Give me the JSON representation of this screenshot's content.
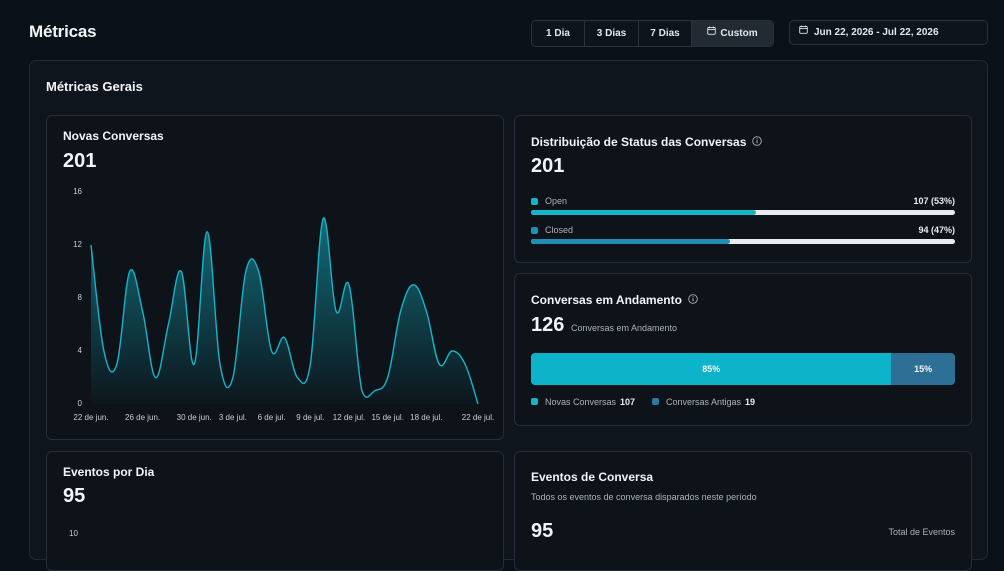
{
  "header": {
    "title": "Métricas",
    "ranges": [
      "1 Dia",
      "3 Dias",
      "7 Dias",
      "Custom"
    ],
    "active_range": "Custom",
    "date_range": "Jun 22, 2026 - Jul 22, 2026"
  },
  "section": {
    "title": "Métricas Gerais"
  },
  "novas_conversas": {
    "title": "Novas Conversas",
    "total": "201"
  },
  "status_dist": {
    "title": "Distribuição de Status das Conversas",
    "total": "201",
    "rows": [
      {
        "label": "Open",
        "value_text": "107 (53%)",
        "fraction": 0.53,
        "color": "#16b4c9"
      },
      {
        "label": "Closed",
        "value_text": "94 (47%)",
        "fraction": 0.47,
        "color": "#1f8fb5"
      }
    ]
  },
  "andamento": {
    "title": "Conversas em Andamento",
    "total": "126",
    "subtitle": "Conversas em Andamento",
    "segments": [
      {
        "label": "85%",
        "fraction": 0.85,
        "color": "#0db4c9"
      },
      {
        "label": "15%",
        "fraction": 0.15,
        "color": "#2e6f96"
      }
    ],
    "legend": [
      {
        "label": "Novas Conversas",
        "value": "107",
        "color": "#16b4c9"
      },
      {
        "label": "Conversas Antigas",
        "value": "19",
        "color": "#2e7aa3"
      }
    ]
  },
  "eventos_dia": {
    "title": "Eventos por Dia",
    "total": "95",
    "y_top_tick": "10"
  },
  "eventos_conversa": {
    "title": "Eventos de Conversa",
    "subtitle": "Todos os eventos de conversa disparados neste período",
    "total": "95",
    "total_label": "Total de Eventos"
  },
  "chart_data": {
    "type": "area",
    "title": "Novas Conversas",
    "xlabel": "",
    "ylabel": "",
    "ylim": [
      0,
      16
    ],
    "y_ticks": [
      "0",
      "4",
      "8",
      "12",
      "16"
    ],
    "x_ticks": [
      "22 de jun.",
      "26 de jun.",
      "30 de jun.",
      "3 de jul.",
      "6 de jul.",
      "9 de jul.",
      "12 de jul.",
      "15 de jul.",
      "18 de jul.",
      "22 de jul."
    ],
    "x": [
      "22 de jun.",
      "23 de jun.",
      "24 de jun.",
      "25 de jun.",
      "26 de jun.",
      "27 de jun.",
      "28 de jun.",
      "29 de jun.",
      "30 de jun.",
      "1 de jul.",
      "2 de jul.",
      "3 de jul.",
      "4 de jul.",
      "5 de jul.",
      "6 de jul.",
      "7 de jul.",
      "8 de jul.",
      "9 de jul.",
      "10 de jul.",
      "11 de jul.",
      "12 de jul.",
      "13 de jul.",
      "14 de jul.",
      "15 de jul.",
      "16 de jul.",
      "17 de jul.",
      "18 de jul.",
      "19 de jul.",
      "20 de jul.",
      "21 de jul.",
      "22 de jul."
    ],
    "values": [
      12,
      4,
      3,
      10,
      7,
      2,
      6,
      10,
      3,
      13,
      3,
      2,
      10,
      10,
      4,
      5,
      2,
      3,
      14,
      7,
      9,
      1,
      1,
      2,
      7,
      9,
      7,
      3,
      4,
      3,
      0
    ],
    "grid": false,
    "legend": "none",
    "color": "#16b4c9"
  }
}
